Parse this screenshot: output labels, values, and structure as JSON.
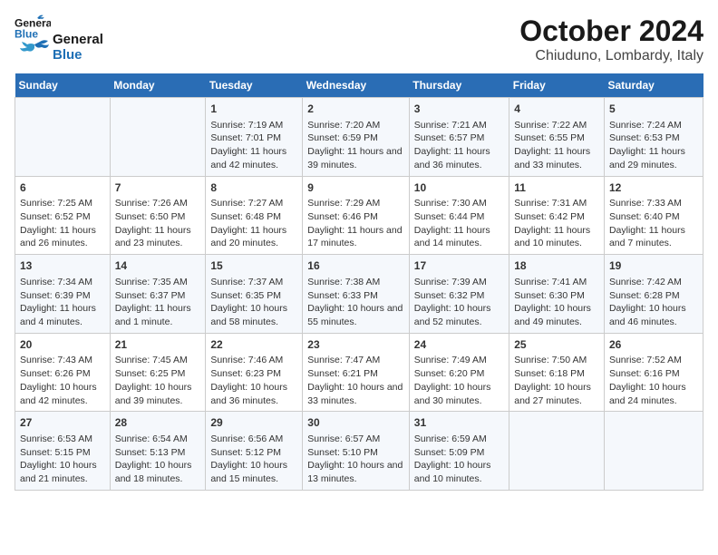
{
  "header": {
    "logo_line1": "General",
    "logo_line2": "Blue",
    "title": "October 2024",
    "subtitle": "Chiuduno, Lombardy, Italy"
  },
  "weekdays": [
    "Sunday",
    "Monday",
    "Tuesday",
    "Wednesday",
    "Thursday",
    "Friday",
    "Saturday"
  ],
  "weeks": [
    [
      {
        "day": "",
        "info": ""
      },
      {
        "day": "",
        "info": ""
      },
      {
        "day": "1",
        "info": "Sunrise: 7:19 AM\nSunset: 7:01 PM\nDaylight: 11 hours and 42 minutes."
      },
      {
        "day": "2",
        "info": "Sunrise: 7:20 AM\nSunset: 6:59 PM\nDaylight: 11 hours and 39 minutes."
      },
      {
        "day": "3",
        "info": "Sunrise: 7:21 AM\nSunset: 6:57 PM\nDaylight: 11 hours and 36 minutes."
      },
      {
        "day": "4",
        "info": "Sunrise: 7:22 AM\nSunset: 6:55 PM\nDaylight: 11 hours and 33 minutes."
      },
      {
        "day": "5",
        "info": "Sunrise: 7:24 AM\nSunset: 6:53 PM\nDaylight: 11 hours and 29 minutes."
      }
    ],
    [
      {
        "day": "6",
        "info": "Sunrise: 7:25 AM\nSunset: 6:52 PM\nDaylight: 11 hours and 26 minutes."
      },
      {
        "day": "7",
        "info": "Sunrise: 7:26 AM\nSunset: 6:50 PM\nDaylight: 11 hours and 23 minutes."
      },
      {
        "day": "8",
        "info": "Sunrise: 7:27 AM\nSunset: 6:48 PM\nDaylight: 11 hours and 20 minutes."
      },
      {
        "day": "9",
        "info": "Sunrise: 7:29 AM\nSunset: 6:46 PM\nDaylight: 11 hours and 17 minutes."
      },
      {
        "day": "10",
        "info": "Sunrise: 7:30 AM\nSunset: 6:44 PM\nDaylight: 11 hours and 14 minutes."
      },
      {
        "day": "11",
        "info": "Sunrise: 7:31 AM\nSunset: 6:42 PM\nDaylight: 11 hours and 10 minutes."
      },
      {
        "day": "12",
        "info": "Sunrise: 7:33 AM\nSunset: 6:40 PM\nDaylight: 11 hours and 7 minutes."
      }
    ],
    [
      {
        "day": "13",
        "info": "Sunrise: 7:34 AM\nSunset: 6:39 PM\nDaylight: 11 hours and 4 minutes."
      },
      {
        "day": "14",
        "info": "Sunrise: 7:35 AM\nSunset: 6:37 PM\nDaylight: 11 hours and 1 minute."
      },
      {
        "day": "15",
        "info": "Sunrise: 7:37 AM\nSunset: 6:35 PM\nDaylight: 10 hours and 58 minutes."
      },
      {
        "day": "16",
        "info": "Sunrise: 7:38 AM\nSunset: 6:33 PM\nDaylight: 10 hours and 55 minutes."
      },
      {
        "day": "17",
        "info": "Sunrise: 7:39 AM\nSunset: 6:32 PM\nDaylight: 10 hours and 52 minutes."
      },
      {
        "day": "18",
        "info": "Sunrise: 7:41 AM\nSunset: 6:30 PM\nDaylight: 10 hours and 49 minutes."
      },
      {
        "day": "19",
        "info": "Sunrise: 7:42 AM\nSunset: 6:28 PM\nDaylight: 10 hours and 46 minutes."
      }
    ],
    [
      {
        "day": "20",
        "info": "Sunrise: 7:43 AM\nSunset: 6:26 PM\nDaylight: 10 hours and 42 minutes."
      },
      {
        "day": "21",
        "info": "Sunrise: 7:45 AM\nSunset: 6:25 PM\nDaylight: 10 hours and 39 minutes."
      },
      {
        "day": "22",
        "info": "Sunrise: 7:46 AM\nSunset: 6:23 PM\nDaylight: 10 hours and 36 minutes."
      },
      {
        "day": "23",
        "info": "Sunrise: 7:47 AM\nSunset: 6:21 PM\nDaylight: 10 hours and 33 minutes."
      },
      {
        "day": "24",
        "info": "Sunrise: 7:49 AM\nSunset: 6:20 PM\nDaylight: 10 hours and 30 minutes."
      },
      {
        "day": "25",
        "info": "Sunrise: 7:50 AM\nSunset: 6:18 PM\nDaylight: 10 hours and 27 minutes."
      },
      {
        "day": "26",
        "info": "Sunrise: 7:52 AM\nSunset: 6:16 PM\nDaylight: 10 hours and 24 minutes."
      }
    ],
    [
      {
        "day": "27",
        "info": "Sunrise: 6:53 AM\nSunset: 5:15 PM\nDaylight: 10 hours and 21 minutes."
      },
      {
        "day": "28",
        "info": "Sunrise: 6:54 AM\nSunset: 5:13 PM\nDaylight: 10 hours and 18 minutes."
      },
      {
        "day": "29",
        "info": "Sunrise: 6:56 AM\nSunset: 5:12 PM\nDaylight: 10 hours and 15 minutes."
      },
      {
        "day": "30",
        "info": "Sunrise: 6:57 AM\nSunset: 5:10 PM\nDaylight: 10 hours and 13 minutes."
      },
      {
        "day": "31",
        "info": "Sunrise: 6:59 AM\nSunset: 5:09 PM\nDaylight: 10 hours and 10 minutes."
      },
      {
        "day": "",
        "info": ""
      },
      {
        "day": "",
        "info": ""
      }
    ]
  ]
}
